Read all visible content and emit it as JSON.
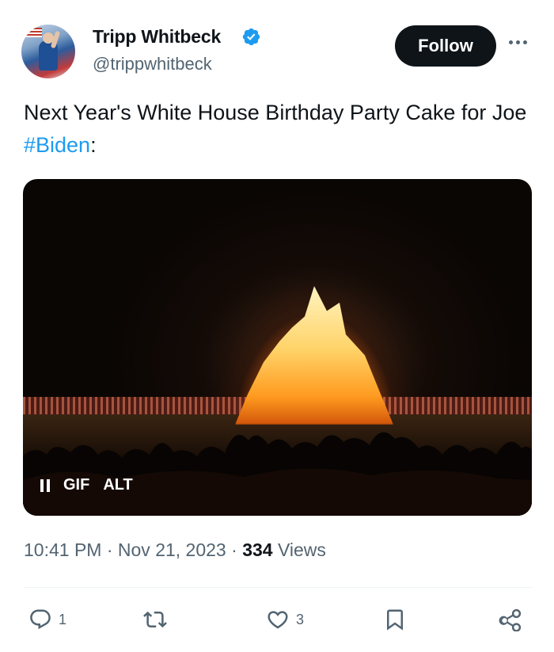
{
  "author": {
    "name": "Tripp Whitbeck",
    "handle": "@trippwhitbeck",
    "verified": true
  },
  "follow_label": "Follow",
  "tweet": {
    "text_before": "Next Year's White House Birthday Party Cake for Joe ",
    "hashtag": "#Biden",
    "text_after": ":"
  },
  "media": {
    "gif_label": "GIF",
    "alt_label": "ALT"
  },
  "meta": {
    "time": "10:41 PM",
    "date": "Nov 21, 2023",
    "views_count": "334",
    "views_label": "Views",
    "separator": " · "
  },
  "actions": {
    "reply_count": "1",
    "repost_count": "",
    "like_count": "3"
  },
  "colors": {
    "accent": "#1d9bf0",
    "text": "#0f1419",
    "secondary": "#536471"
  }
}
